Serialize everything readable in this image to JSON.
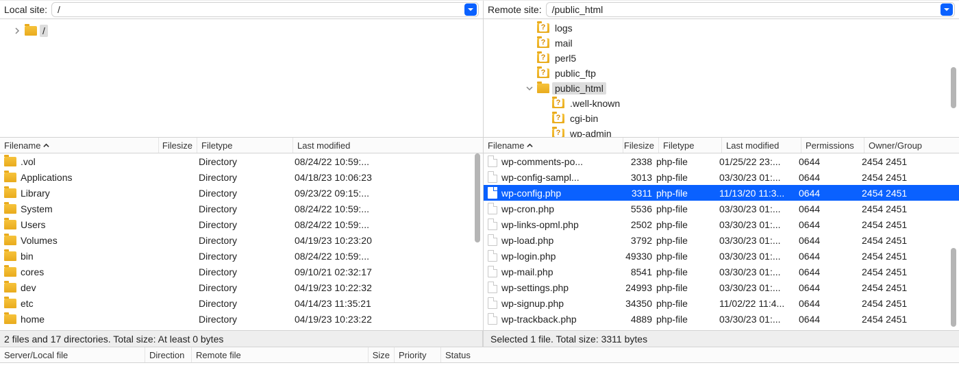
{
  "local": {
    "label": "Local site:",
    "path": "/",
    "tree_root": "/",
    "columns": {
      "name": "Filename",
      "size": "Filesize",
      "type": "Filetype",
      "mod": "Last modified"
    },
    "files": [
      {
        "name": ".vol",
        "size": "",
        "type": "Directory",
        "mod": "08/24/22 10:59:..."
      },
      {
        "name": "Applications",
        "size": "",
        "type": "Directory",
        "mod": "04/18/23 10:06:23"
      },
      {
        "name": "Library",
        "size": "",
        "type": "Directory",
        "mod": "09/23/22 09:15:..."
      },
      {
        "name": "System",
        "size": "",
        "type": "Directory",
        "mod": "08/24/22 10:59:..."
      },
      {
        "name": "Users",
        "size": "",
        "type": "Directory",
        "mod": "08/24/22 10:59:..."
      },
      {
        "name": "Volumes",
        "size": "",
        "type": "Directory",
        "mod": "04/19/23 10:23:20"
      },
      {
        "name": "bin",
        "size": "",
        "type": "Directory",
        "mod": "08/24/22 10:59:..."
      },
      {
        "name": "cores",
        "size": "",
        "type": "Directory",
        "mod": "09/10/21 02:32:17"
      },
      {
        "name": "dev",
        "size": "",
        "type": "Directory",
        "mod": "04/19/23 10:22:32"
      },
      {
        "name": "etc",
        "size": "",
        "type": "Directory",
        "mod": "04/14/23 11:35:21"
      },
      {
        "name": "home",
        "size": "",
        "type": "Directory",
        "mod": "04/19/23 10:23:22"
      }
    ],
    "status": "2 files and 17 directories. Total size: At least 0 bytes"
  },
  "remote": {
    "label": "Remote site:",
    "path": "/public_html",
    "tree": [
      {
        "indent": 2,
        "name": "logs",
        "q": true
      },
      {
        "indent": 2,
        "name": "mail",
        "q": true
      },
      {
        "indent": 2,
        "name": "perl5",
        "q": true
      },
      {
        "indent": 2,
        "name": "public_ftp",
        "q": true
      },
      {
        "indent": 2,
        "name": "public_html",
        "q": false,
        "expanded": true,
        "selected": true
      },
      {
        "indent": 3,
        "name": ".well-known",
        "q": true
      },
      {
        "indent": 3,
        "name": "cgi-bin",
        "q": true
      },
      {
        "indent": 3,
        "name": "wp-admin",
        "q": true
      }
    ],
    "columns": {
      "name": "Filename",
      "size": "Filesize",
      "type": "Filetype",
      "mod": "Last modified",
      "perm": "Permissions",
      "own": "Owner/Group"
    },
    "files": [
      {
        "name": "wp-comments-po...",
        "size": "2338",
        "type": "php-file",
        "mod": "01/25/22 23:...",
        "perm": "0644",
        "own": "2454 2451"
      },
      {
        "name": "wp-config-sampl...",
        "size": "3013",
        "type": "php-file",
        "mod": "03/30/23 01:...",
        "perm": "0644",
        "own": "2454 2451"
      },
      {
        "name": "wp-config.php",
        "size": "3311",
        "type": "php-file",
        "mod": "11/13/20 11:3...",
        "perm": "0644",
        "own": "2454 2451",
        "selected": true
      },
      {
        "name": "wp-cron.php",
        "size": "5536",
        "type": "php-file",
        "mod": "03/30/23 01:...",
        "perm": "0644",
        "own": "2454 2451"
      },
      {
        "name": "wp-links-opml.php",
        "size": "2502",
        "type": "php-file",
        "mod": "03/30/23 01:...",
        "perm": "0644",
        "own": "2454 2451"
      },
      {
        "name": "wp-load.php",
        "size": "3792",
        "type": "php-file",
        "mod": "03/30/23 01:...",
        "perm": "0644",
        "own": "2454 2451"
      },
      {
        "name": "wp-login.php",
        "size": "49330",
        "type": "php-file",
        "mod": "03/30/23 01:...",
        "perm": "0644",
        "own": "2454 2451"
      },
      {
        "name": "wp-mail.php",
        "size": "8541",
        "type": "php-file",
        "mod": "03/30/23 01:...",
        "perm": "0644",
        "own": "2454 2451"
      },
      {
        "name": "wp-settings.php",
        "size": "24993",
        "type": "php-file",
        "mod": "03/30/23 01:...",
        "perm": "0644",
        "own": "2454 2451"
      },
      {
        "name": "wp-signup.php",
        "size": "34350",
        "type": "php-file",
        "mod": "11/02/22 11:4...",
        "perm": "0644",
        "own": "2454 2451"
      },
      {
        "name": "wp-trackback.php",
        "size": "4889",
        "type": "php-file",
        "mod": "03/30/23 01:...",
        "perm": "0644",
        "own": "2454 2451"
      }
    ],
    "status": "Selected 1 file. Total size: 3311 bytes"
  },
  "queue": {
    "columns": {
      "server": "Server/Local file",
      "dir": "Direction",
      "remote": "Remote file",
      "size": "Size",
      "prio": "Priority",
      "status": "Status"
    }
  }
}
